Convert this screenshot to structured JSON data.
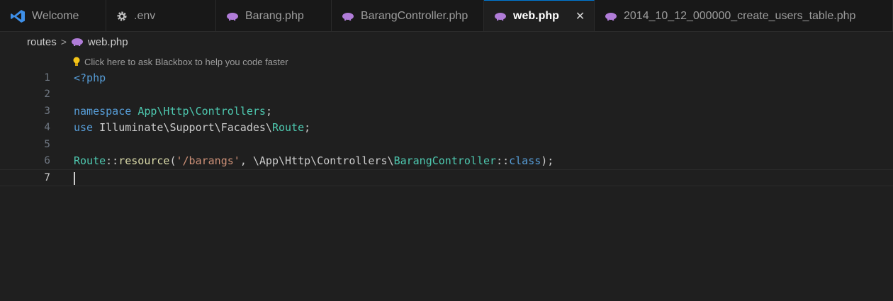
{
  "tabs": [
    {
      "label": "Welcome",
      "icon": "vscode-icon",
      "active": false
    },
    {
      "label": ".env",
      "icon": "gear-icon",
      "active": false
    },
    {
      "label": "Barang.php",
      "icon": "php-icon",
      "active": false
    },
    {
      "label": "BarangController.php",
      "icon": "php-icon",
      "active": false
    },
    {
      "label": "web.php",
      "icon": "php-icon",
      "active": true,
      "close": "✕"
    },
    {
      "label": "2014_10_12_000000_create_users_table.php",
      "icon": "php-icon",
      "active": false
    }
  ],
  "breadcrumb": {
    "folder": "routes",
    "separator": ">",
    "file": "web.php"
  },
  "hint": "Click here to ask Blackbox to help you code faster",
  "lines": [
    {
      "n": "1",
      "tokens": [
        {
          "t": "<?php",
          "c": "kw"
        }
      ]
    },
    {
      "n": "2",
      "tokens": []
    },
    {
      "n": "3",
      "tokens": [
        {
          "t": "namespace ",
          "c": "kw"
        },
        {
          "t": "App\\Http\\Controllers",
          "c": "ty"
        },
        {
          "t": ";",
          "c": "pl"
        }
      ]
    },
    {
      "n": "4",
      "tokens": [
        {
          "t": "use ",
          "c": "kw"
        },
        {
          "t": "Illuminate\\Support\\Facades\\",
          "c": "pl"
        },
        {
          "t": "Route",
          "c": "ty"
        },
        {
          "t": ";",
          "c": "pl"
        }
      ]
    },
    {
      "n": "5",
      "tokens": []
    },
    {
      "n": "6",
      "tokens": [
        {
          "t": "Route",
          "c": "ty"
        },
        {
          "t": "::",
          "c": "pl"
        },
        {
          "t": "resource",
          "c": "fn"
        },
        {
          "t": "(",
          "c": "pl"
        },
        {
          "t": "'/barangs'",
          "c": "st"
        },
        {
          "t": ", \\App\\Http\\Controllers\\",
          "c": "pl"
        },
        {
          "t": "BarangController",
          "c": "ty"
        },
        {
          "t": "::",
          "c": "pl"
        },
        {
          "t": "class",
          "c": "kw"
        },
        {
          "t": ");",
          "c": "pl"
        }
      ]
    },
    {
      "n": "7",
      "tokens": [],
      "current": true
    }
  ],
  "colors": {
    "accent": "#0078d4",
    "php_icon": "#b07cd8",
    "bulb": "#f5c518",
    "vscode": "#3e8fe8"
  }
}
